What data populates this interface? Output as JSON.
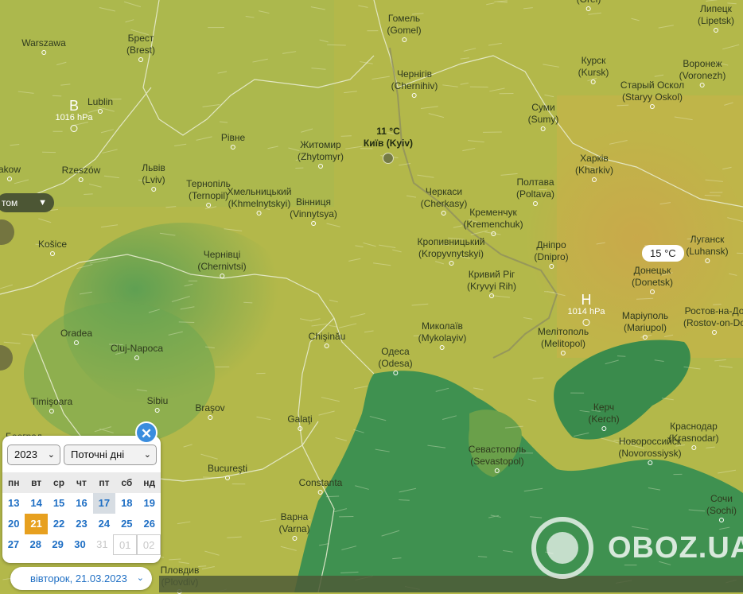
{
  "colors": {
    "land_yellow": "#b6b94a",
    "sea_green": "#3d8f4e",
    "accent_blue": "#1f6fc4",
    "today_orange": "#e7a01f",
    "close_blue": "#3a8dde"
  },
  "cities": [
    {
      "id": "orel",
      "label": "(Orel)"
    },
    {
      "id": "gomel",
      "label": "Гомель",
      "sub": "(Gomel)"
    },
    {
      "id": "lipetsk",
      "label": "Липецк",
      "sub": "(Lipetsk)"
    },
    {
      "id": "warszawa",
      "label": "Warszawa"
    },
    {
      "id": "brest",
      "label": "Брест",
      "sub": "(Brest)"
    },
    {
      "id": "chernihiv",
      "label": "Чернігів",
      "sub": "(Chernihiv)"
    },
    {
      "id": "kursk",
      "label": "Курск",
      "sub": "(Kursk)"
    },
    {
      "id": "voronezh",
      "label": "Воронеж",
      "sub": "(Voronezh)"
    },
    {
      "id": "lublin",
      "label": "Lublin"
    },
    {
      "id": "staryy_oskol",
      "label": "Старый Оскол",
      "sub": "(Staryy Oskol)"
    },
    {
      "id": "sumy",
      "label": "Суми",
      "sub": "(Sumy)"
    },
    {
      "id": "rivne",
      "label": "Рівне"
    },
    {
      "id": "zhytomyr",
      "label": "Житомир",
      "sub": "(Zhytomyr)"
    },
    {
      "id": "krakow",
      "label": "akow"
    },
    {
      "id": "rzeszow",
      "label": "Rzeszów"
    },
    {
      "id": "lviv",
      "label": "Львів",
      "sub": "(Lviv)"
    },
    {
      "id": "kharkiv",
      "label": "Харків",
      "sub": "(Kharkiv)"
    },
    {
      "id": "ternopil",
      "label": "Тернопіль",
      "sub": "(Ternopil)"
    },
    {
      "id": "khmelnytskyi",
      "label": "Хмельницький",
      "sub": "(Khmelnytskyi)"
    },
    {
      "id": "vinnytsia",
      "label": "Вінниця",
      "sub": "(Vinnytsya)"
    },
    {
      "id": "cherkasy",
      "label": "Черкаси",
      "sub": "(Cherkasy)"
    },
    {
      "id": "poltava",
      "label": "Полтава",
      "sub": "(Poltava)"
    },
    {
      "id": "kremenchuk",
      "label": "Кременчук",
      "sub": "(Kremenchuk)"
    },
    {
      "id": "kosice",
      "label": "Košice"
    },
    {
      "id": "kropyvnytskyi",
      "label": "Кропивницький",
      "sub": "(Kropyvnytskyi)"
    },
    {
      "id": "dnipro",
      "label": "Дніпро",
      "sub": "(Dnipro)"
    },
    {
      "id": "luhansk",
      "label": "Луганск",
      "sub": "(Luhansk)"
    },
    {
      "id": "chernivtsi",
      "label": "Чернівці",
      "sub": "(Chernivtsi)"
    },
    {
      "id": "kryvyi_rih",
      "label": "Кривий Ріг",
      "sub": "(Kryvyi Rih)"
    },
    {
      "id": "donetsk",
      "label": "Донецьк",
      "sub": "(Donetsk)"
    },
    {
      "id": "mariupol",
      "label": "Маріуполь",
      "sub": "(Mariupol)"
    },
    {
      "id": "rostov",
      "label": "Ростов-на-До",
      "sub": "(Rostov-on-Do"
    },
    {
      "id": "oradea",
      "label": "Oradea"
    },
    {
      "id": "mykolaiv",
      "label": "Миколаїв",
      "sub": "(Mykolayiv)"
    },
    {
      "id": "cluj",
      "label": "Cluj-Napoca"
    },
    {
      "id": "chisinau",
      "label": "Chişinău"
    },
    {
      "id": "melitopol",
      "label": "Мелітополь",
      "sub": "(Melitopol)"
    },
    {
      "id": "odesa",
      "label": "Одеса",
      "sub": "(Odesa)"
    },
    {
      "id": "timisoara",
      "label": "Timişoara"
    },
    {
      "id": "sibiu",
      "label": "Sibiu"
    },
    {
      "id": "brasov",
      "label": "Braşov"
    },
    {
      "id": "kerch",
      "label": "Керч",
      "sub": "(Kerch)"
    },
    {
      "id": "galati",
      "label": "Galaţi"
    },
    {
      "id": "krasnodar",
      "label": "Краснодар",
      "sub": "(Krasnodar)"
    },
    {
      "id": "novorossiysk",
      "label": "Новороссийск",
      "sub": "(Novorossiysk)"
    },
    {
      "id": "sevastopol",
      "label": "Севастополь",
      "sub": "(Sevastopol)"
    },
    {
      "id": "bucuresti",
      "label": "Bucureşti"
    },
    {
      "id": "constanta",
      "label": "Constanta"
    },
    {
      "id": "sochi",
      "label": "Сочи",
      "sub": "(Sochi)"
    },
    {
      "id": "varna",
      "label": "Варна",
      "sub": "(Varna)"
    },
    {
      "id": "plovdiv",
      "label": "Пловдив",
      "sub": "(Plovdiv)"
    },
    {
      "id": "belgrade",
      "label": "Београд"
    }
  ],
  "pressure": {
    "low": {
      "letter": "B",
      "value": "1016 hPa"
    },
    "high": {
      "letter": "H",
      "value": "1014 hPa"
    }
  },
  "kyiv": {
    "temp": "11 °C",
    "name": "Київ (Kyiv)"
  },
  "donetsk_temp": "15 °C",
  "layer_pill": {
    "label": "том"
  },
  "calendar": {
    "year": "2023",
    "mode": "Поточні дні",
    "weekdays": [
      "пн",
      "вт",
      "ср",
      "чт",
      "пт",
      "сб",
      "нд"
    ],
    "weeks": [
      [
        "13",
        "14",
        "15",
        "16",
        "17",
        "18",
        "19"
      ],
      [
        "20",
        "21",
        "22",
        "23",
        "24",
        "25",
        "26"
      ],
      [
        "27",
        "28",
        "29",
        "30",
        "31",
        "01",
        "02"
      ]
    ],
    "today": "21",
    "close": "✕"
  },
  "date_button": {
    "label": "вівторок, 21.03.2023"
  },
  "watermark": {
    "text": "OBOZ.UA"
  }
}
